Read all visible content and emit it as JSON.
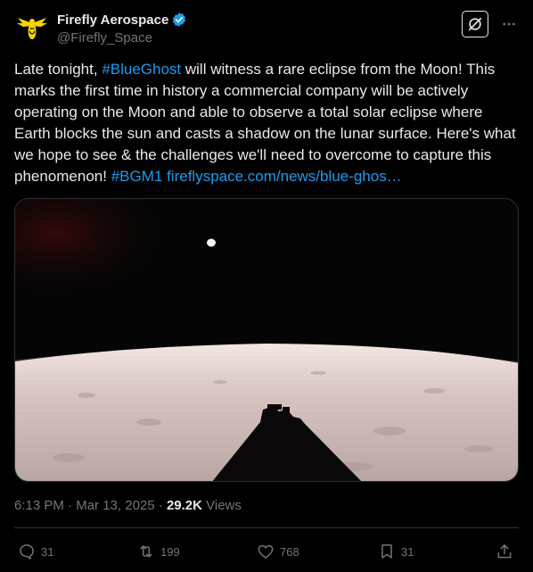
{
  "author": {
    "display_name": "Firefly Aerospace",
    "handle": "@Firefly_Space",
    "verified": true,
    "avatar_icon": "firefly-logo-icon",
    "avatar_color": "#f5d500"
  },
  "tweet": {
    "text_parts": [
      {
        "text": "Late tonight, ",
        "link": false
      },
      {
        "text": "#BlueGhost",
        "link": true
      },
      {
        "text": " will witness a rare eclipse from the Moon! This marks the first time in history a commercial company will be actively operating on the Moon and able to observe a total solar eclipse where Earth blocks the sun and casts a shadow on the lunar surface. Here's what we hope to see & the challenges we'll need to overcome to capture this phenomenon! ",
        "link": false
      },
      {
        "text": "#BGM1",
        "link": true
      },
      {
        "text": " ",
        "link": false
      },
      {
        "text": "fireflyspace.com/news/blue-ghos…",
        "link": true
      }
    ],
    "link_color": "#1d9bf0"
  },
  "meta": {
    "time": "6:13 PM",
    "separator": " · ",
    "date": "Mar 13, 2025",
    "separator2": " · ",
    "views_count": "29.2K",
    "views_label": " Views"
  },
  "actions": {
    "replies": "31",
    "reposts": "199",
    "likes": "768",
    "bookmarks": "31"
  },
  "icons": {
    "reply": "reply-icon",
    "repost": "repost-icon",
    "like": "heart-icon",
    "bookmark": "bookmark-icon",
    "share": "share-icon",
    "grok": "grok-icon",
    "more": "more-icon",
    "verified": "verified-badge-icon"
  }
}
